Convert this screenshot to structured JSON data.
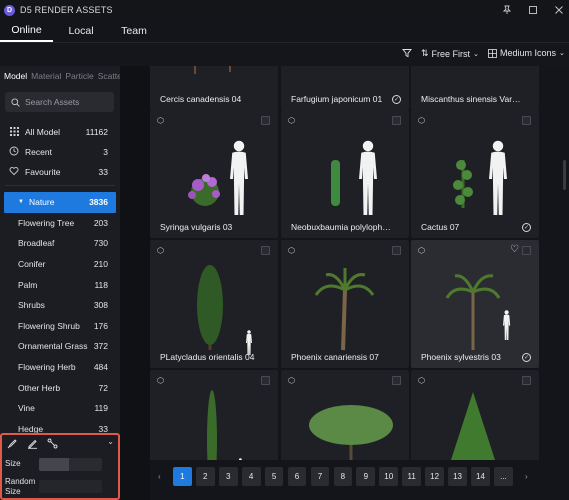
{
  "app": {
    "logo_letter": "D",
    "title": "D5 RENDER ASSETS"
  },
  "window_controls": [
    "pin-icon",
    "maximize-icon",
    "close-icon"
  ],
  "tabs": [
    {
      "label": "Online",
      "active": true
    },
    {
      "label": "Local",
      "active": false
    },
    {
      "label": "Team",
      "active": false
    }
  ],
  "toolbar": {
    "filter_icon": "filter-icon",
    "sort_label": "Free First",
    "view_label": "Medium Icons"
  },
  "sidebar": {
    "sub_tabs": [
      "Model",
      "Material",
      "Particle",
      "Scatter"
    ],
    "search_placeholder": "Search Assets",
    "quick": [
      {
        "label": "All Model",
        "count": "11162",
        "icon": "grid-icon"
      },
      {
        "label": "Recent",
        "count": "3",
        "icon": "clock-icon"
      },
      {
        "label": "Favourite",
        "count": "33",
        "icon": "heart-icon"
      }
    ],
    "categories": [
      {
        "label": "Nature",
        "count": "3836",
        "selected": true
      },
      {
        "label": "Flowering Tree",
        "count": "203"
      },
      {
        "label": "Broadleaf",
        "count": "730"
      },
      {
        "label": "Conifer",
        "count": "210"
      },
      {
        "label": "Palm",
        "count": "118"
      },
      {
        "label": "Shrubs",
        "count": "308"
      },
      {
        "label": "Flowering Shrub",
        "count": "176"
      },
      {
        "label": "Ornamental Grass",
        "count": "372"
      },
      {
        "label": "Flowering Herb",
        "count": "484"
      },
      {
        "label": "Other Herb",
        "count": "72"
      },
      {
        "label": "Vine",
        "count": "119"
      },
      {
        "label": "Hedge",
        "count": "33"
      }
    ],
    "tool_panel": {
      "icons": [
        "brush-icon",
        "pen-icon",
        "line-tool-icon"
      ],
      "size_label": "Size",
      "size_level": 0.48,
      "random_size_label": "Random\nSize"
    }
  },
  "grid": {
    "cards": [
      {
        "name": "Cercis canadensis 04",
        "downloaded": false
      },
      {
        "name": "Farfugium japonicum 01",
        "downloaded": true
      },
      {
        "name": "Miscanthus sinensis Varie...",
        "downloaded": false
      },
      {
        "name": "Syringa vulgaris 03",
        "downloaded": false
      },
      {
        "name": "Neobuxbaumia polylopha ...",
        "downloaded": false
      },
      {
        "name": "Cactus 07",
        "downloaded": true
      },
      {
        "name": "PLatycladus orientalis 04",
        "downloaded": false
      },
      {
        "name": "Phoenix canariensis 07",
        "downloaded": false
      },
      {
        "name": "Phoenix sylvestris 03",
        "downloaded": true,
        "hover": true
      },
      {
        "name": "",
        "downloaded": false
      },
      {
        "name": "",
        "downloaded": false
      },
      {
        "name": "",
        "downloaded": false
      }
    ]
  },
  "pagination": {
    "pages": [
      "1",
      "2",
      "3",
      "4",
      "5",
      "6",
      "7",
      "8",
      "9",
      "10",
      "11",
      "12",
      "13",
      "14",
      "..."
    ],
    "current": "1",
    "prev": "‹",
    "next": "›"
  },
  "colors": {
    "accent": "#1f7ae0",
    "highlight_border": "#e05a4c",
    "background": "#14151a",
    "sidebar": "#1c1d22",
    "card": "#1f2025"
  }
}
